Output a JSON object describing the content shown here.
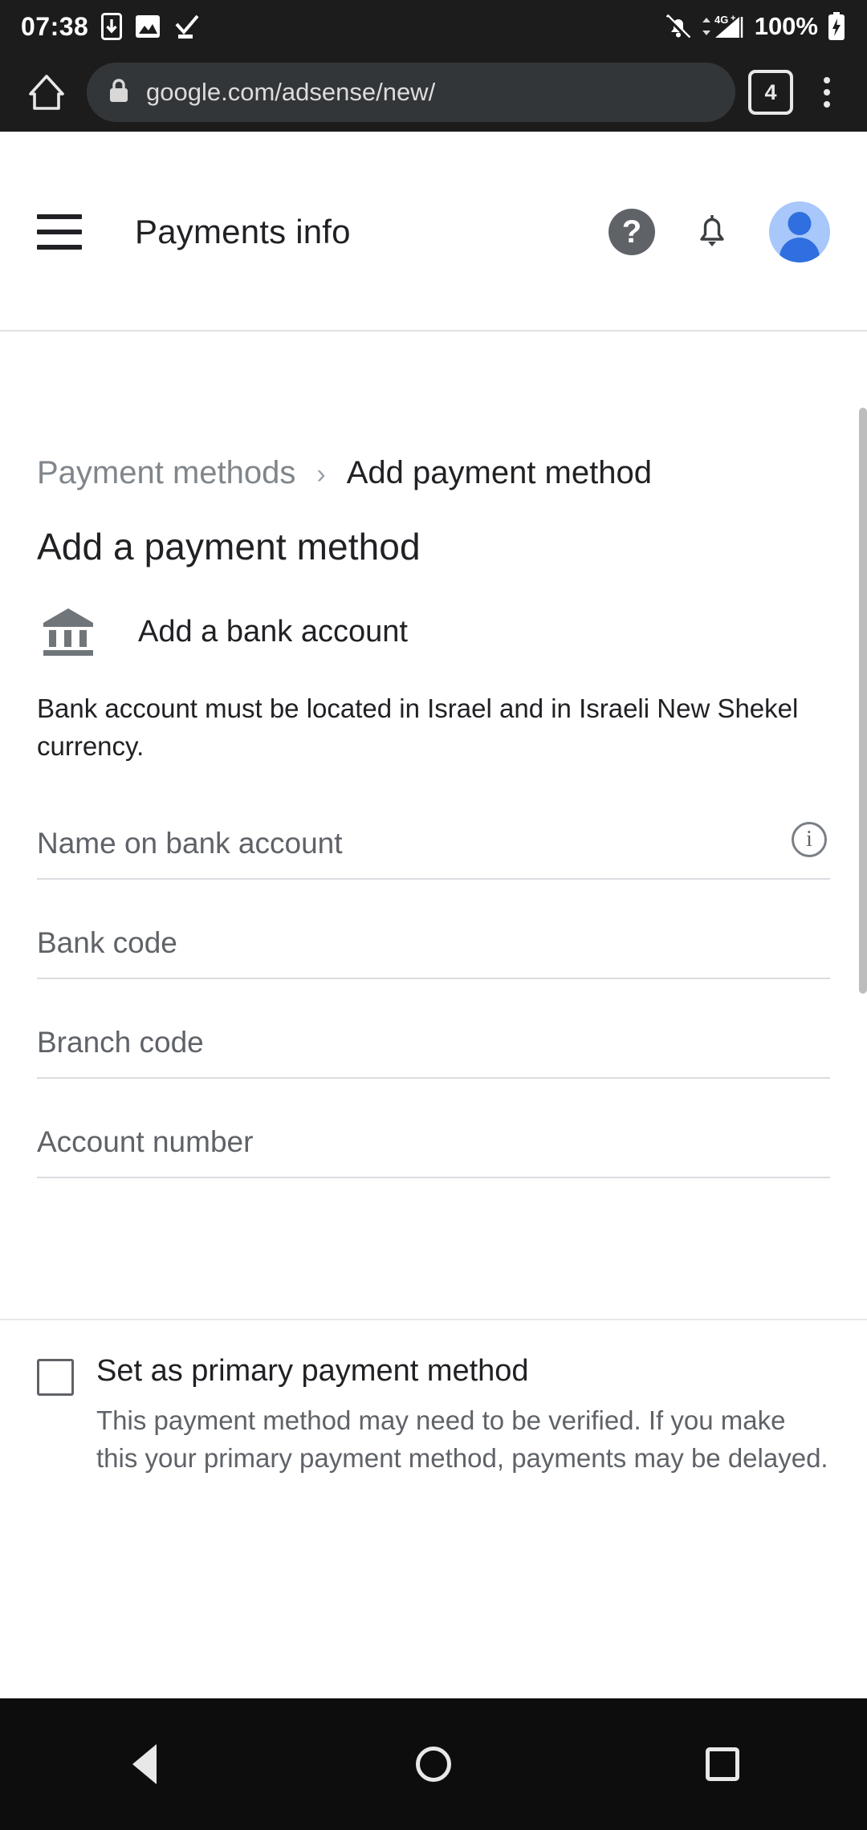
{
  "status_bar": {
    "time": "07:38",
    "battery_percent": "100%",
    "network_type": "4G+",
    "icons": [
      "phone-download-icon",
      "image-icon",
      "check-underline-icon",
      "bell-muted-icon",
      "signal-4g-plus-icon",
      "battery-charging-icon"
    ]
  },
  "browser": {
    "url": "google.com/adsense/new/",
    "tab_count": "4",
    "lock_icon": "lock-icon",
    "home_icon": "home-icon",
    "overflow_icon": "more-vertical-icon"
  },
  "app_header": {
    "title": "Payments info",
    "menu_icon": "hamburger-icon",
    "help_icon": "help-circle-icon",
    "notifications_icon": "bell-icon",
    "account_icon": "account-avatar-icon"
  },
  "breadcrumb": {
    "parent": "Payment methods",
    "separator": "›",
    "current": "Add payment method"
  },
  "page": {
    "title": "Add a payment method",
    "bank_option_label": "Add a bank account",
    "bank_icon": "bank-building-icon",
    "note": "Bank account must be located in Israel and in Israeli New Shekel currency."
  },
  "form": {
    "fields": [
      {
        "placeholder": "Name on bank account",
        "value": "",
        "has_info_icon": true
      },
      {
        "placeholder": "Bank code",
        "value": "",
        "has_info_icon": false
      },
      {
        "placeholder": "Branch code",
        "value": "",
        "has_info_icon": false
      },
      {
        "placeholder": "Account number",
        "value": "",
        "has_info_icon": false
      }
    ]
  },
  "primary_method": {
    "checkbox_label": "Set as primary payment method",
    "checked": false,
    "description": "This payment method may need to be verified. If you make this your primary payment method, payments may be delayed."
  },
  "nav_bar": {
    "back": "back-triangle-icon",
    "home": "home-circle-icon",
    "recents": "recents-square-icon"
  },
  "colors": {
    "chrome_bg": "#1c1c1c",
    "omnibox_bg": "#333638",
    "avatar_bg": "#a8c7fa",
    "avatar_fg": "#2f6fe0",
    "text_primary": "#202124",
    "text_secondary": "#5f6368",
    "divider": "#dadce0"
  }
}
